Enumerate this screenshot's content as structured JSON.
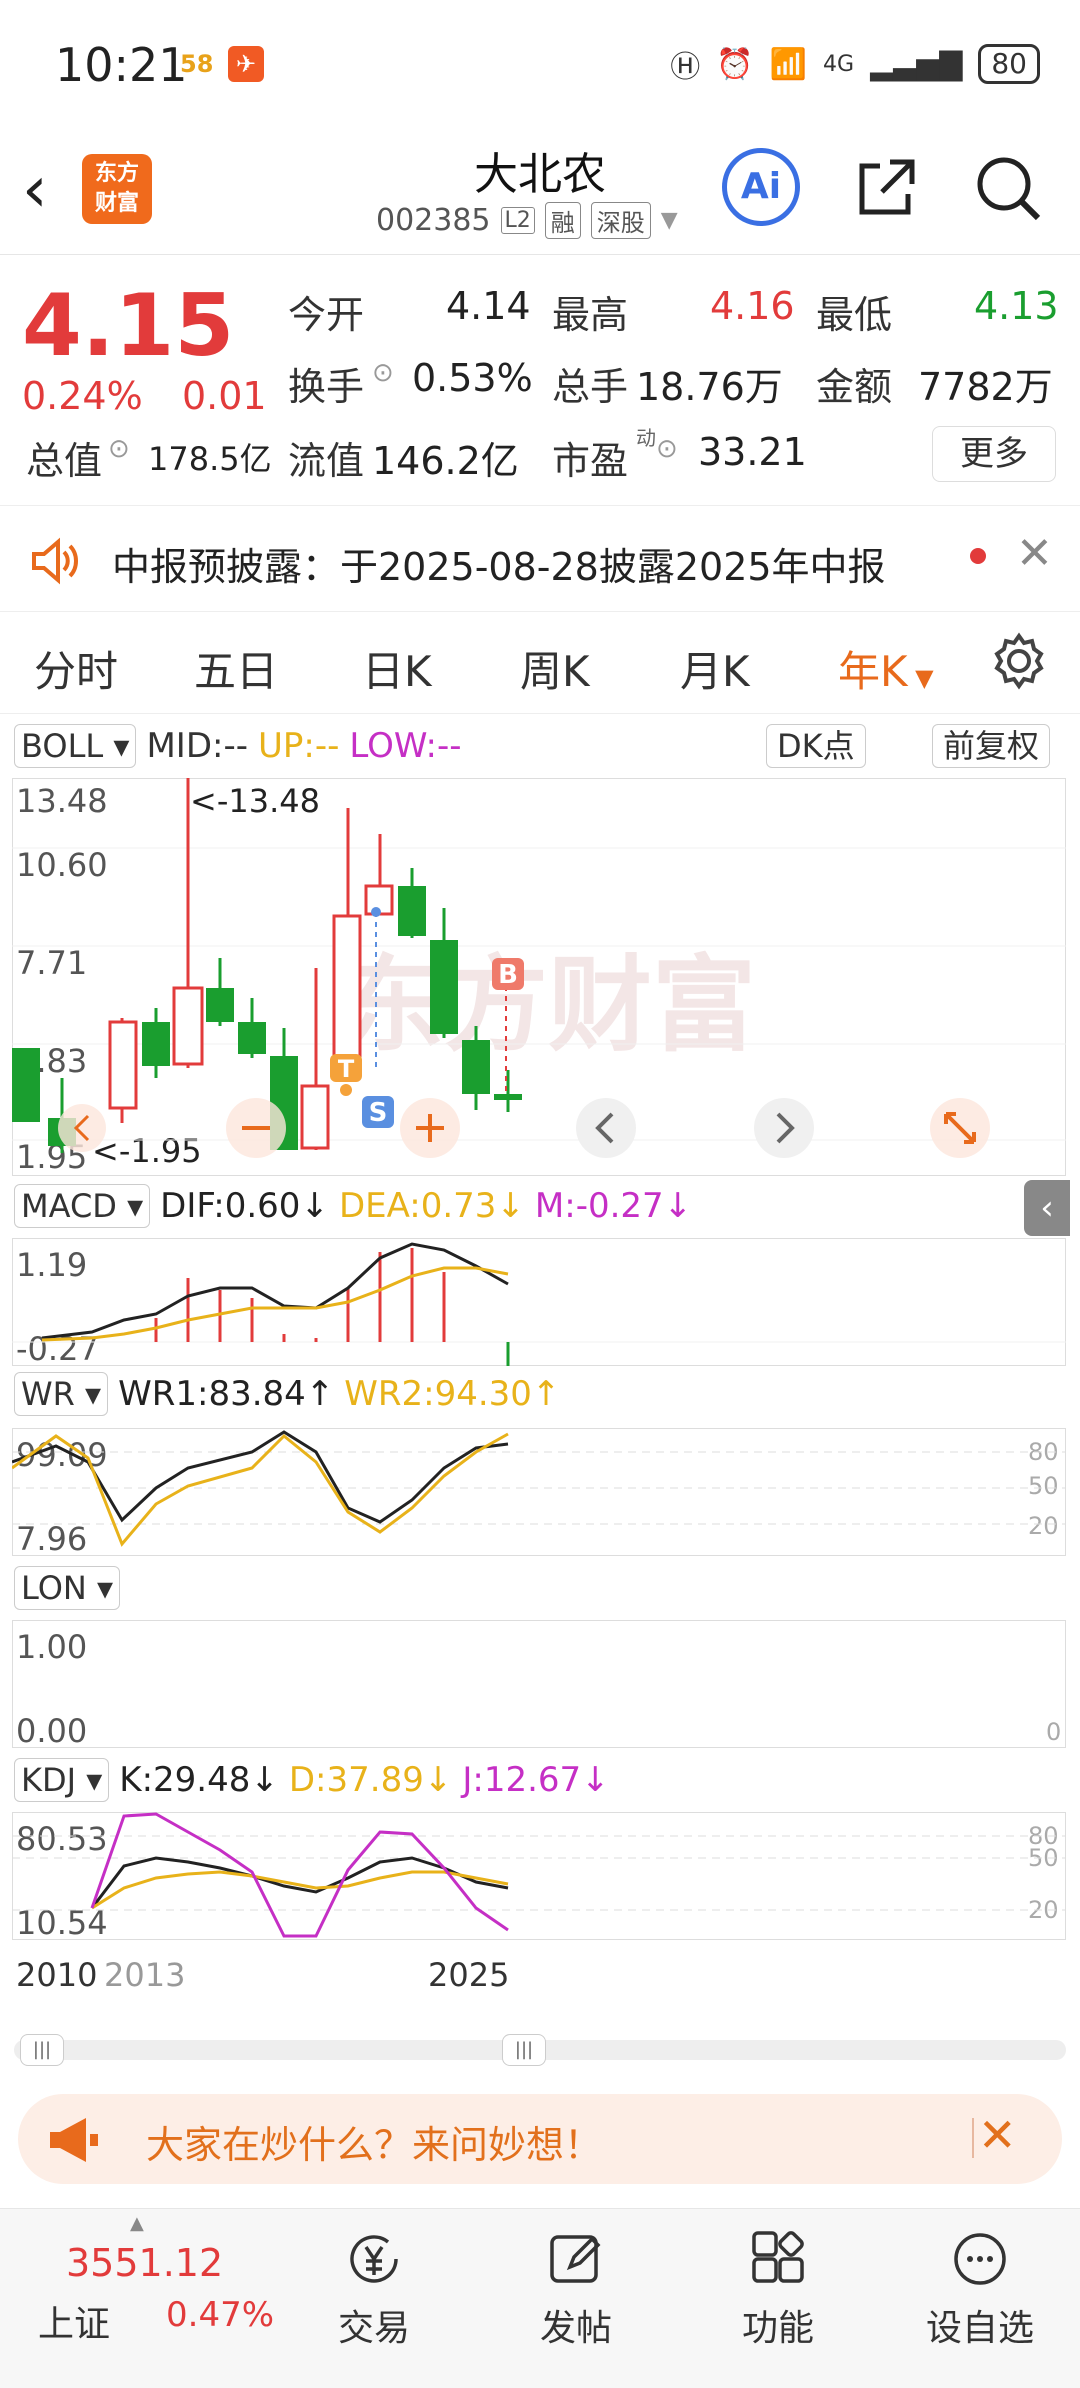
{
  "status": {
    "time": "10:21",
    "badge": "58",
    "network": "4G",
    "battery": "80"
  },
  "header": {
    "title": "大北农",
    "code": "002385",
    "level": "L2",
    "margin": "融",
    "market": "深股",
    "ai": "Ai"
  },
  "logo": {
    "line1": "东方",
    "line2": "财富"
  },
  "quote": {
    "price": "4.15",
    "pct": "0.24%",
    "chg": "0.01",
    "open_label": "今开",
    "open": "4.14",
    "high_label": "最高",
    "high": "4.16",
    "low_label": "最低",
    "low": "4.13",
    "turnover_label": "换手",
    "turnover": "0.53%",
    "volume_label": "总手",
    "volume": "18.76万",
    "amount_label": "金额",
    "amount": "7782万",
    "mcap_label": "总值",
    "mcap": "178.5亿",
    "float_label": "流值",
    "float": "146.2亿",
    "pe_label": "市盈",
    "pe_sup": "动",
    "pe": "33.21",
    "more": "更多"
  },
  "notice": {
    "text": "中报预披露：于2025-08-28披露2025年中报"
  },
  "tabs": [
    "分时",
    "五日",
    "日K",
    "周K",
    "月K",
    "年K"
  ],
  "boll": {
    "name": "BOLL",
    "mid": "MID:--",
    "up": "UP:--",
    "low": "LOW:--",
    "dk": "DK点",
    "fq": "前复权",
    "axis": [
      "13.48",
      "10.60",
      "7.71",
      "4.83",
      "1.95"
    ],
    "max_label": "<-13.48",
    "min_label": "<-1.95",
    "watermark": "东方财富"
  },
  "macd": {
    "name": "MACD",
    "dif": "DIF:0.60↓",
    "dea": "DEA:0.73↓",
    "m": "M:-0.27↓",
    "axis": [
      "1.19",
      "-0.27"
    ]
  },
  "wr": {
    "name": "WR",
    "wr1": "WR1:83.84↑",
    "wr2": "WR2:94.30↑",
    "axis": [
      "99.09",
      "7.96"
    ],
    "rlevels": [
      "80",
      "50",
      "20"
    ]
  },
  "lon": {
    "name": "LON",
    "axis": [
      "1.00",
      "0.00"
    ],
    "right": "0"
  },
  "kdj": {
    "name": "KDJ",
    "k": "K:29.48↓",
    "d": "D:37.89↓",
    "j": "J:12.67↓",
    "axis": [
      "80.53",
      "10.54"
    ],
    "rlevels": [
      "80",
      "50",
      "20"
    ]
  },
  "xaxis": {
    "start": "2010",
    "mid": "2013",
    "end": "2025"
  },
  "promo": {
    "text": "大家在炒什么？来问妙想！"
  },
  "bottom": {
    "index_value": "3551.12",
    "index_name": "上证",
    "index_pct": "0.47%",
    "items": [
      "交易",
      "发帖",
      "功能",
      "设自选"
    ]
  },
  "colors": {
    "up": "#e23b3b",
    "down": "#1a9e2f",
    "accent": "#e86a1c",
    "yellow": "#e8b21a",
    "magenta": "#c52fc5"
  }
}
